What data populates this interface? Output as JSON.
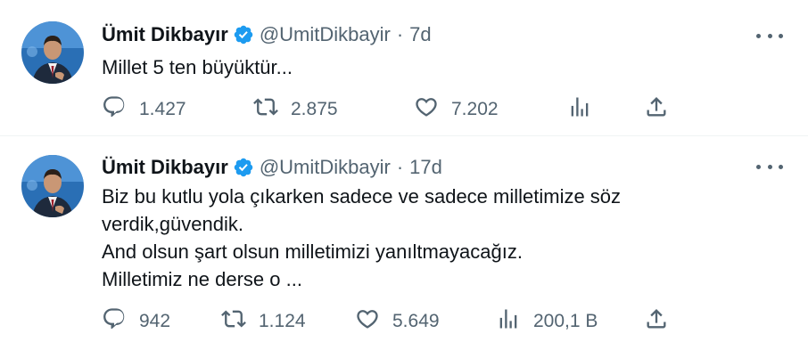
{
  "colors": {
    "text": "#0f1419",
    "secondary": "#536471",
    "verified": "#1d9bf0",
    "divider": "#eff3f4"
  },
  "tweets": [
    {
      "author_name": "Ümit Dikbayır",
      "handle": "@UmitDikbayir",
      "separator": "·",
      "time": "7d",
      "lines": [
        "Millet 5 ten büyüktür..."
      ],
      "replies": "1.427",
      "retweets": "2.875",
      "likes": "7.202",
      "views": ""
    },
    {
      "author_name": "Ümit Dikbayır",
      "handle": "@UmitDikbayir",
      "separator": "·",
      "time": "17d",
      "lines": [
        "Biz bu kutlu yola çıkarken sadece ve sadece milletimize söz",
        "verdik,güvendik.",
        "And olsun şart olsun milletimizi yanıltmayacağız.",
        "Milletimiz ne derse o ..."
      ],
      "replies": "942",
      "retweets": "1.124",
      "likes": "5.649",
      "views": "200,1 B"
    }
  ],
  "icons": [
    "avatar",
    "verified-badge-icon",
    "more-options-icon",
    "reply-icon",
    "retweet-icon",
    "like-icon",
    "views-icon",
    "share-icon"
  ]
}
